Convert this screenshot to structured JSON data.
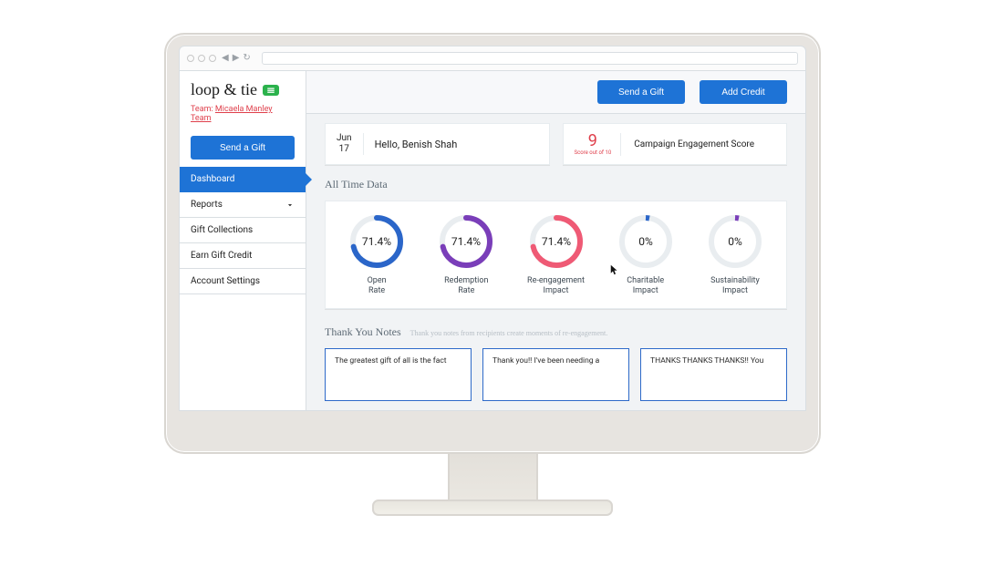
{
  "brand": {
    "name": "loop & tie",
    "tag_color": "#2bb24c"
  },
  "team": {
    "label": "Team:",
    "name": "Micaela Manley Team"
  },
  "sidebar": {
    "send_label": "Send a Gift",
    "items": [
      {
        "label": "Dashboard",
        "active": true,
        "chevron": false
      },
      {
        "label": "Reports",
        "active": false,
        "chevron": true
      },
      {
        "label": "Gift Collections",
        "active": false,
        "chevron": false
      },
      {
        "label": "Earn Gift Credit",
        "active": false,
        "chevron": false
      },
      {
        "label": "Account Settings",
        "active": false,
        "chevron": false
      }
    ]
  },
  "header_buttons": {
    "send": "Send a Gift",
    "credit": "Add Credit"
  },
  "hello": {
    "month": "Jun",
    "day": "17",
    "greeting": "Hello, Benish Shah"
  },
  "score": {
    "value": "9",
    "scale": "Score out of 10",
    "label": "Campaign Engagement Score"
  },
  "sections": {
    "all_time": "All Time Data",
    "notes_title": "Thank You Notes",
    "notes_subtitle": "Thank you notes from recipients create moments of re-engagement."
  },
  "chart_data": [
    {
      "type": "pie",
      "title": "Open Rate",
      "color": "#2b66c9",
      "values": [
        71.4
      ],
      "value_label": "71.4%"
    },
    {
      "type": "pie",
      "title": "Redemption Rate",
      "color": "#7a3eb9",
      "values": [
        71.4
      ],
      "value_label": "71.4%"
    },
    {
      "type": "pie",
      "title": "Re-engagement Impact",
      "color": "#ef5a75",
      "values": [
        71.4
      ],
      "value_label": "71.4%"
    },
    {
      "type": "pie",
      "title": "Charitable Impact",
      "color": "#2b66c9",
      "values": [
        0
      ],
      "value_label": "0%"
    },
    {
      "type": "pie",
      "title": "Sustainability Impact",
      "color": "#7a3eb9",
      "values": [
        0
      ],
      "value_label": "0%"
    }
  ],
  "notes": [
    "The greatest gift of all is the fact",
    "Thank you!! I've been needing a",
    "THANKS THANKS THANKS!! You"
  ]
}
